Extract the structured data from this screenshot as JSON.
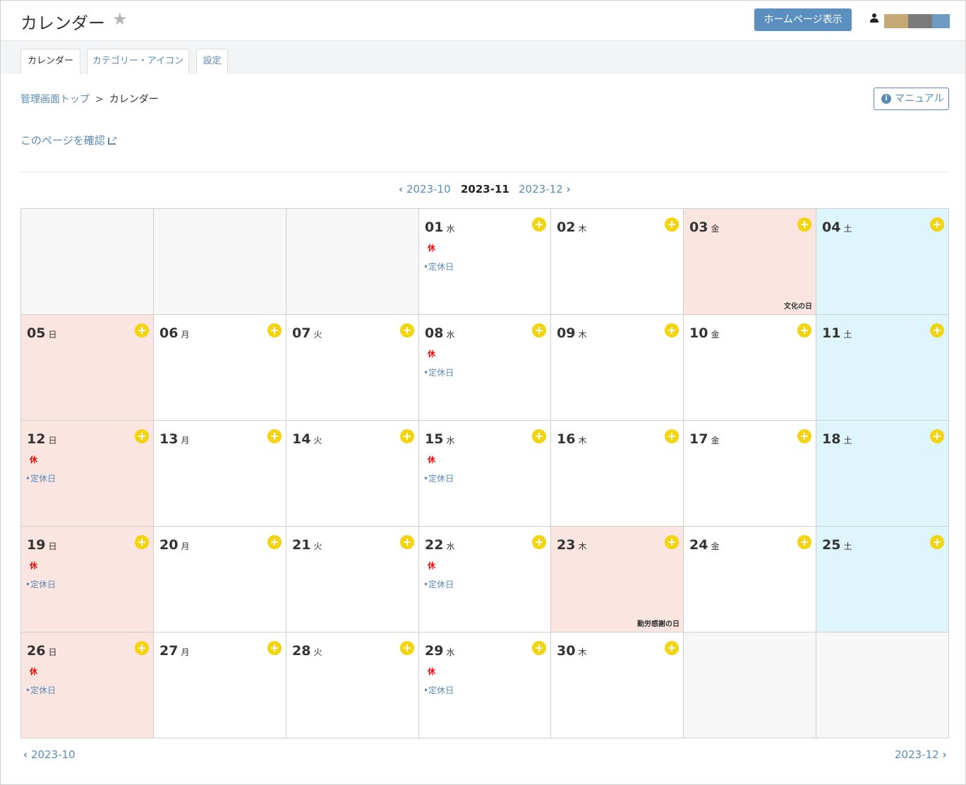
{
  "header": {
    "title": "カレンダー",
    "star": "★",
    "homepage_button": "ホームページ表示",
    "user_chip_colors": [
      "#c4a975",
      "#7a7a7a",
      "#6d9bc1"
    ]
  },
  "tabs": [
    {
      "label": "カレンダー",
      "active": true
    },
    {
      "label": "カテゴリー・アイコン",
      "active": false
    },
    {
      "label": "設定",
      "active": false
    }
  ],
  "breadcrumb": {
    "top": "管理画面トップ",
    "sep": ">",
    "current": "カレンダー"
  },
  "manual_button": {
    "icon": "i",
    "label": "マニュアル"
  },
  "confirm_link": "このページを確認",
  "month_nav": {
    "prev": "2023-10",
    "current": "2023-11",
    "next": "2023-12",
    "prev_chevron": "‹",
    "next_chevron": "›"
  },
  "footer_nav": {
    "prev": "2023-10",
    "next": "2023-12",
    "prev_chevron": "‹",
    "next_chevron": "›"
  },
  "colors": {
    "accent": "#5a8ab5",
    "weekend_sun": "#fbe5e1",
    "weekend_sat": "#def5fb",
    "add_button": "#f3d40e",
    "closed": "#ee0000"
  },
  "calendar": {
    "weeks": [
      [
        {
          "empty": true
        },
        {
          "empty": true
        },
        {
          "empty": true
        },
        {
          "day": "01",
          "dow": "水",
          "closed": "休",
          "event": "•定休日"
        },
        {
          "day": "02",
          "dow": "木"
        },
        {
          "day": "03",
          "dow": "金",
          "holiday": "文化の日",
          "type": "hol"
        },
        {
          "day": "04",
          "dow": "土",
          "type": "sat"
        }
      ],
      [
        {
          "day": "05",
          "dow": "日",
          "type": "sun"
        },
        {
          "day": "06",
          "dow": "月"
        },
        {
          "day": "07",
          "dow": "火"
        },
        {
          "day": "08",
          "dow": "水",
          "closed": "休",
          "event": "•定休日"
        },
        {
          "day": "09",
          "dow": "木"
        },
        {
          "day": "10",
          "dow": "金"
        },
        {
          "day": "11",
          "dow": "土",
          "type": "sat"
        }
      ],
      [
        {
          "day": "12",
          "dow": "日",
          "type": "sun",
          "closed": "休",
          "event": "•定休日"
        },
        {
          "day": "13",
          "dow": "月"
        },
        {
          "day": "14",
          "dow": "火"
        },
        {
          "day": "15",
          "dow": "水",
          "closed": "休",
          "event": "•定休日"
        },
        {
          "day": "16",
          "dow": "木"
        },
        {
          "day": "17",
          "dow": "金"
        },
        {
          "day": "18",
          "dow": "土",
          "type": "sat"
        }
      ],
      [
        {
          "day": "19",
          "dow": "日",
          "type": "sun",
          "closed": "休",
          "event": "•定休日"
        },
        {
          "day": "20",
          "dow": "月"
        },
        {
          "day": "21",
          "dow": "火"
        },
        {
          "day": "22",
          "dow": "水",
          "closed": "休",
          "event": "•定休日"
        },
        {
          "day": "23",
          "dow": "木",
          "holiday": "勤労感謝の日",
          "type": "hol"
        },
        {
          "day": "24",
          "dow": "金"
        },
        {
          "day": "25",
          "dow": "土",
          "type": "sat"
        }
      ],
      [
        {
          "day": "26",
          "dow": "日",
          "type": "sun",
          "closed": "休",
          "event": "•定休日"
        },
        {
          "day": "27",
          "dow": "月"
        },
        {
          "day": "28",
          "dow": "火"
        },
        {
          "day": "29",
          "dow": "水",
          "closed": "休",
          "event": "•定休日"
        },
        {
          "day": "30",
          "dow": "木"
        },
        {
          "empty": true
        },
        {
          "empty": true
        }
      ]
    ]
  }
}
